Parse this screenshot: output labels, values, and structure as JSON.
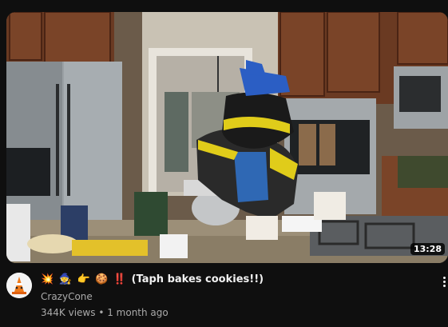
{
  "video": {
    "duration": "13:28",
    "title_emojis": [
      "💥",
      "🧙",
      "👉",
      "🍪",
      "‼️"
    ],
    "title_text": "(Taph bakes cookies!!)",
    "channel": "CrazyCone",
    "views": "344K views",
    "separator": "•",
    "age": "1 month ago"
  },
  "icons": {
    "avatar": "traffic-cone-avatar",
    "menu": "more-vertical-icon"
  },
  "colors": {
    "background": "#0f0f0f",
    "secondary_text": "#aaaaaa",
    "primary_text": "#f1f1f1"
  }
}
